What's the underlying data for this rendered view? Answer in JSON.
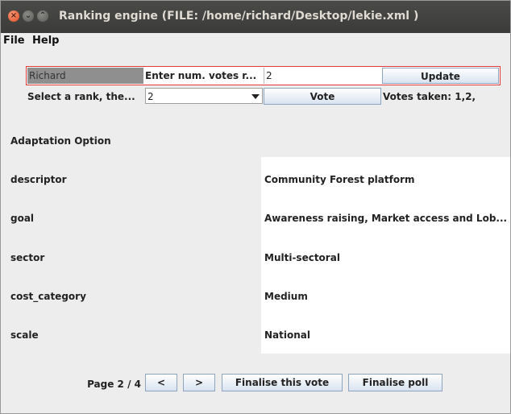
{
  "window": {
    "title": "Ranking engine  (FILE: /home/richard/Desktop/lekie.xml )"
  },
  "menu": [
    "File",
    "Help"
  ],
  "voter": {
    "name_value": "Richard",
    "votes_prompt": "Enter num. votes r...",
    "votes_value": "2",
    "update_label": "Update"
  },
  "vote_row": {
    "select_label": "Select a rank, the...",
    "rank_value": "2",
    "vote_label": "Vote",
    "votes_taken": "Votes taken: 1,2,"
  },
  "option_heading": "Adaptation Option",
  "attributes": [
    {
      "key": "descriptor",
      "value": "Community Forest platform"
    },
    {
      "key": "goal",
      "value": "Awareness raising, Market access and Lob..."
    },
    {
      "key": "sector",
      "value": "Multi-sectoral"
    },
    {
      "key": "cost_category",
      "value": "Medium"
    },
    {
      "key": "scale",
      "value": "National"
    }
  ],
  "paging": {
    "page_label": "Page 2 / 4",
    "prev_label": "<",
    "next_label": ">",
    "finalise_vote_label": "Finalise this vote",
    "finalise_poll_label": "Finalise poll"
  }
}
